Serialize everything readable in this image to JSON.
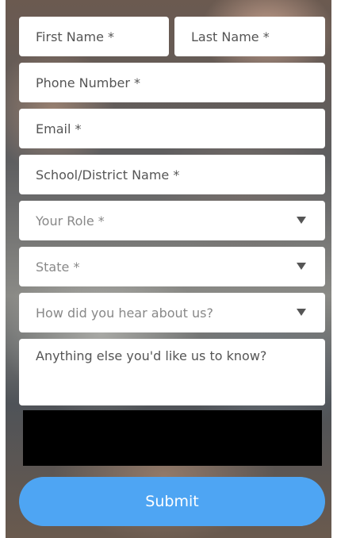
{
  "form": {
    "first_name_placeholder": "First Name *",
    "last_name_placeholder": "Last Name *",
    "phone_placeholder": "Phone Number *",
    "email_placeholder": "Email *",
    "school_placeholder": "School/District Name *",
    "role_placeholder": "Your Role *",
    "state_placeholder": "State *",
    "referral_placeholder": "How did you hear about us?",
    "comments_placeholder": "Anything else you'd like us to know?",
    "submit_label": "Submit"
  },
  "colors": {
    "submit_button": "#4ea5f3",
    "field_background": "#ffffff",
    "captcha_block": "#000000"
  }
}
